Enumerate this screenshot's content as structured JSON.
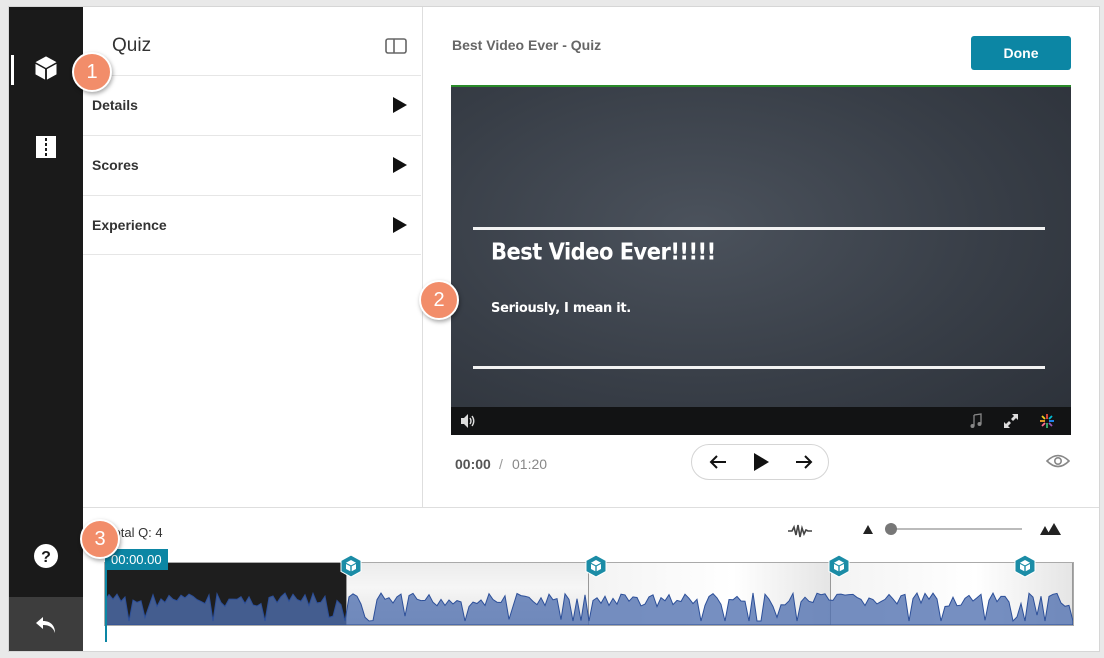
{
  "sidebar": {
    "items": [
      {
        "name": "quiz-cube",
        "icon": "cube-icon",
        "active": true
      },
      {
        "name": "chapters",
        "icon": "book-icon",
        "active": false
      }
    ],
    "help_icon": "help-circle-icon",
    "back_icon": "undo-arrow-icon"
  },
  "panel": {
    "title": "Quiz",
    "toggle_icon": "panel-toggle-icon",
    "sections": [
      {
        "label": "Details"
      },
      {
        "label": "Scores"
      },
      {
        "label": "Experience"
      }
    ]
  },
  "header": {
    "video_title": "Best Video Ever - Quiz",
    "done_label": "Done"
  },
  "player": {
    "slide_heading": "Best Video Ever!!!!!",
    "slide_subheading": "Seriously, I mean it.",
    "bar_icons": [
      "volume-icon",
      "music-note-icon",
      "fullscreen-icon",
      "brand-icon"
    ]
  },
  "playback": {
    "current_time": "00:00",
    "separator": "/",
    "total_time": "01:20"
  },
  "timeline": {
    "total_label": "Total Q: 4",
    "playhead_time": "00:00.00",
    "zoom_level": 0.05,
    "question_count": 4
  },
  "callouts": [
    "1",
    "2",
    "3"
  ],
  "colors": {
    "accent": "#0c86a4",
    "rail": "#1a1a1a",
    "callout": "#f28d6a",
    "waveform": "#4f6fb0"
  }
}
